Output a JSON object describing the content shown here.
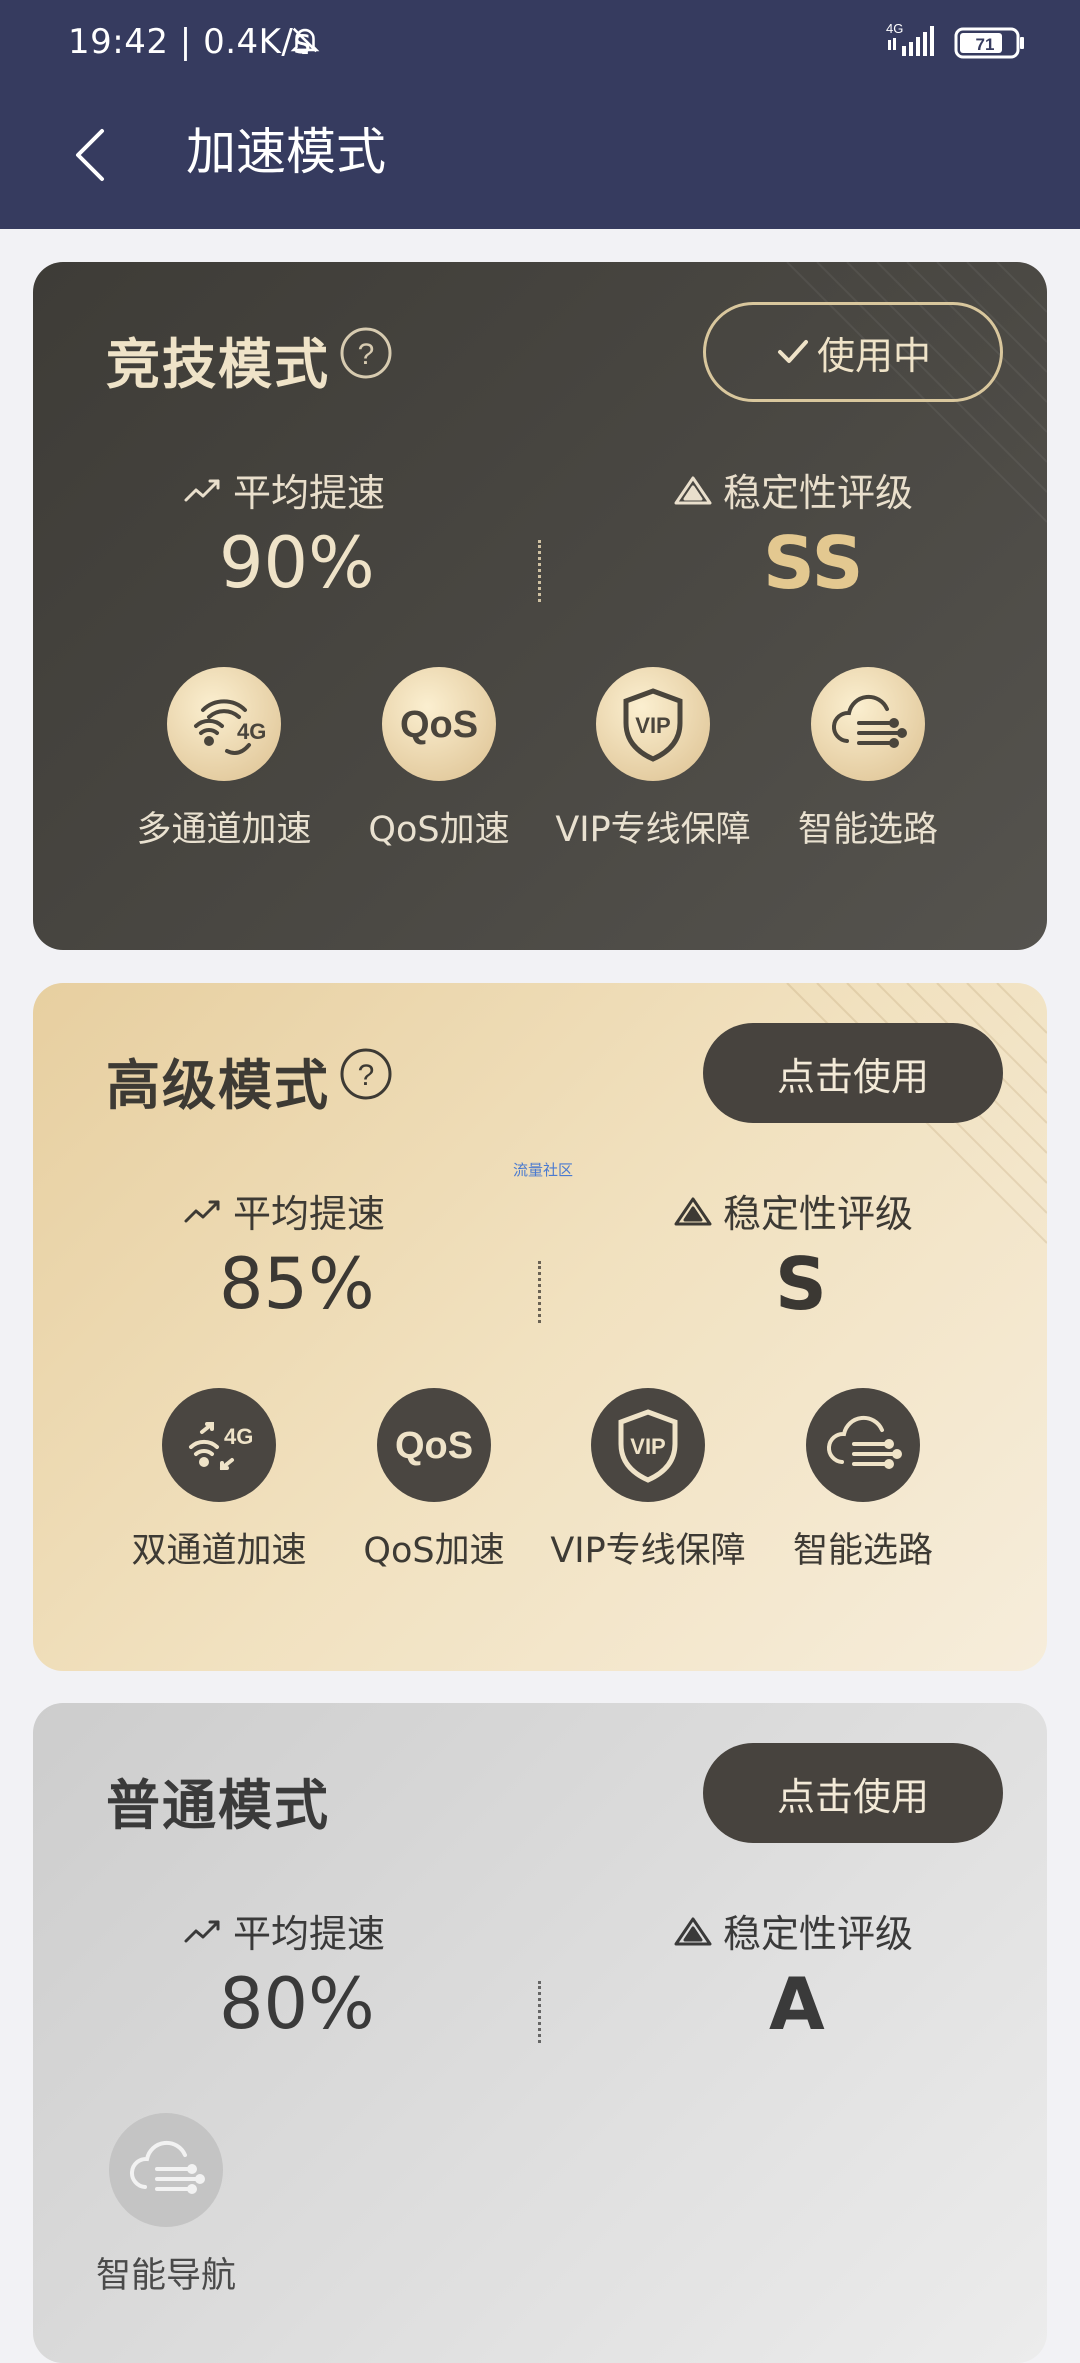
{
  "status": {
    "time": "19:42",
    "speed": "0.4K/s",
    "network": "4G",
    "battery": "71"
  },
  "header": {
    "title": "加速模式"
  },
  "cards": [
    {
      "title": "竞技模式",
      "button": "使用中",
      "avg_label": "平均提速",
      "avg_value": "90%",
      "rating_label": "稳定性评级",
      "rating_value": "SS",
      "features": [
        {
          "label": "多通道加速",
          "icon_text": "4G"
        },
        {
          "label": "QoS加速",
          "icon_text": "QoS"
        },
        {
          "label": "VIP专线保障",
          "icon_text": "VIP"
        },
        {
          "label": "智能选路"
        }
      ]
    },
    {
      "title": "高级模式",
      "button": "点击使用",
      "watermark": "流量社区",
      "avg_label": "平均提速",
      "avg_value": "85%",
      "rating_label": "稳定性评级",
      "rating_value": "S",
      "features": [
        {
          "label": "双通道加速",
          "icon_text": "4G"
        },
        {
          "label": "QoS加速",
          "icon_text": "QoS"
        },
        {
          "label": "VIP专线保障",
          "icon_text": "VIP"
        },
        {
          "label": "智能选路"
        }
      ]
    },
    {
      "title": "普通模式",
      "button": "点击使用",
      "avg_label": "平均提速",
      "avg_value": "80%",
      "rating_label": "稳定性评级",
      "rating_value": "A",
      "features": [
        {
          "label": "智能导航"
        }
      ]
    }
  ]
}
